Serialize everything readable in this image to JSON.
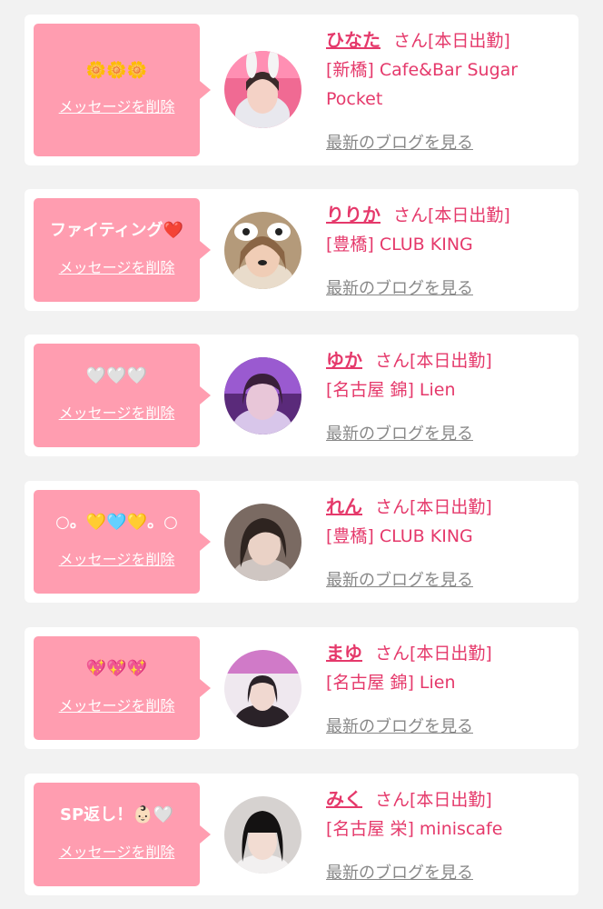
{
  "colors": {
    "accent": "#e5396b",
    "bubble": "#ff9db0",
    "link_gray": "#888888",
    "background": "#f2f2f2"
  },
  "cards": [
    {
      "message": "🌼🌼🌼",
      "delete_label": "メッセージを削除",
      "name": "ひなた",
      "suffix": "さん[本日出勤]",
      "shop": "[新橋] Cafe&Bar Sugar Pocket",
      "blog_label": "最新のブログを見る",
      "avatar_icon": "avatar-bunny-ears"
    },
    {
      "message": "ファイティング❤️",
      "delete_label": "メッセージを削除",
      "name": "りりか",
      "suffix": "さん[本日出勤]",
      "shop": "[豊橋] CLUB KING",
      "blog_label": "最新のブログを見る",
      "avatar_icon": "avatar-dog-filter"
    },
    {
      "message": "🤍🤍🤍",
      "delete_label": "メッセージを削除",
      "name": "ゆか",
      "suffix": "さん[本日出勤]",
      "shop": "[名古屋 錦] Lien",
      "blog_label": "最新のブログを見る",
      "avatar_icon": "avatar-purple-light"
    },
    {
      "message": "○。💛🩵💛。○",
      "delete_label": "メッセージを削除",
      "name": "れん",
      "suffix": "さん[本日出勤]",
      "shop": "[豊橋] CLUB KING",
      "blog_label": "最新のブログを見る",
      "avatar_icon": "avatar-portrait"
    },
    {
      "message": "💖💖💖",
      "delete_label": "メッセージを削除",
      "name": "まゆ",
      "suffix": "さん[本日出勤]",
      "shop": "[名古屋 錦] Lien",
      "blog_label": "最新のブログを見る",
      "avatar_icon": "avatar-lien-sign"
    },
    {
      "message": "SP返し！👶🏻🤍",
      "delete_label": "メッセージを削除",
      "name": "みく",
      "suffix": "さん[本日出勤]",
      "shop": "[名古屋 栄] miniscafe",
      "blog_label": "最新のブログを見る",
      "avatar_icon": "avatar-dark-hair"
    }
  ]
}
